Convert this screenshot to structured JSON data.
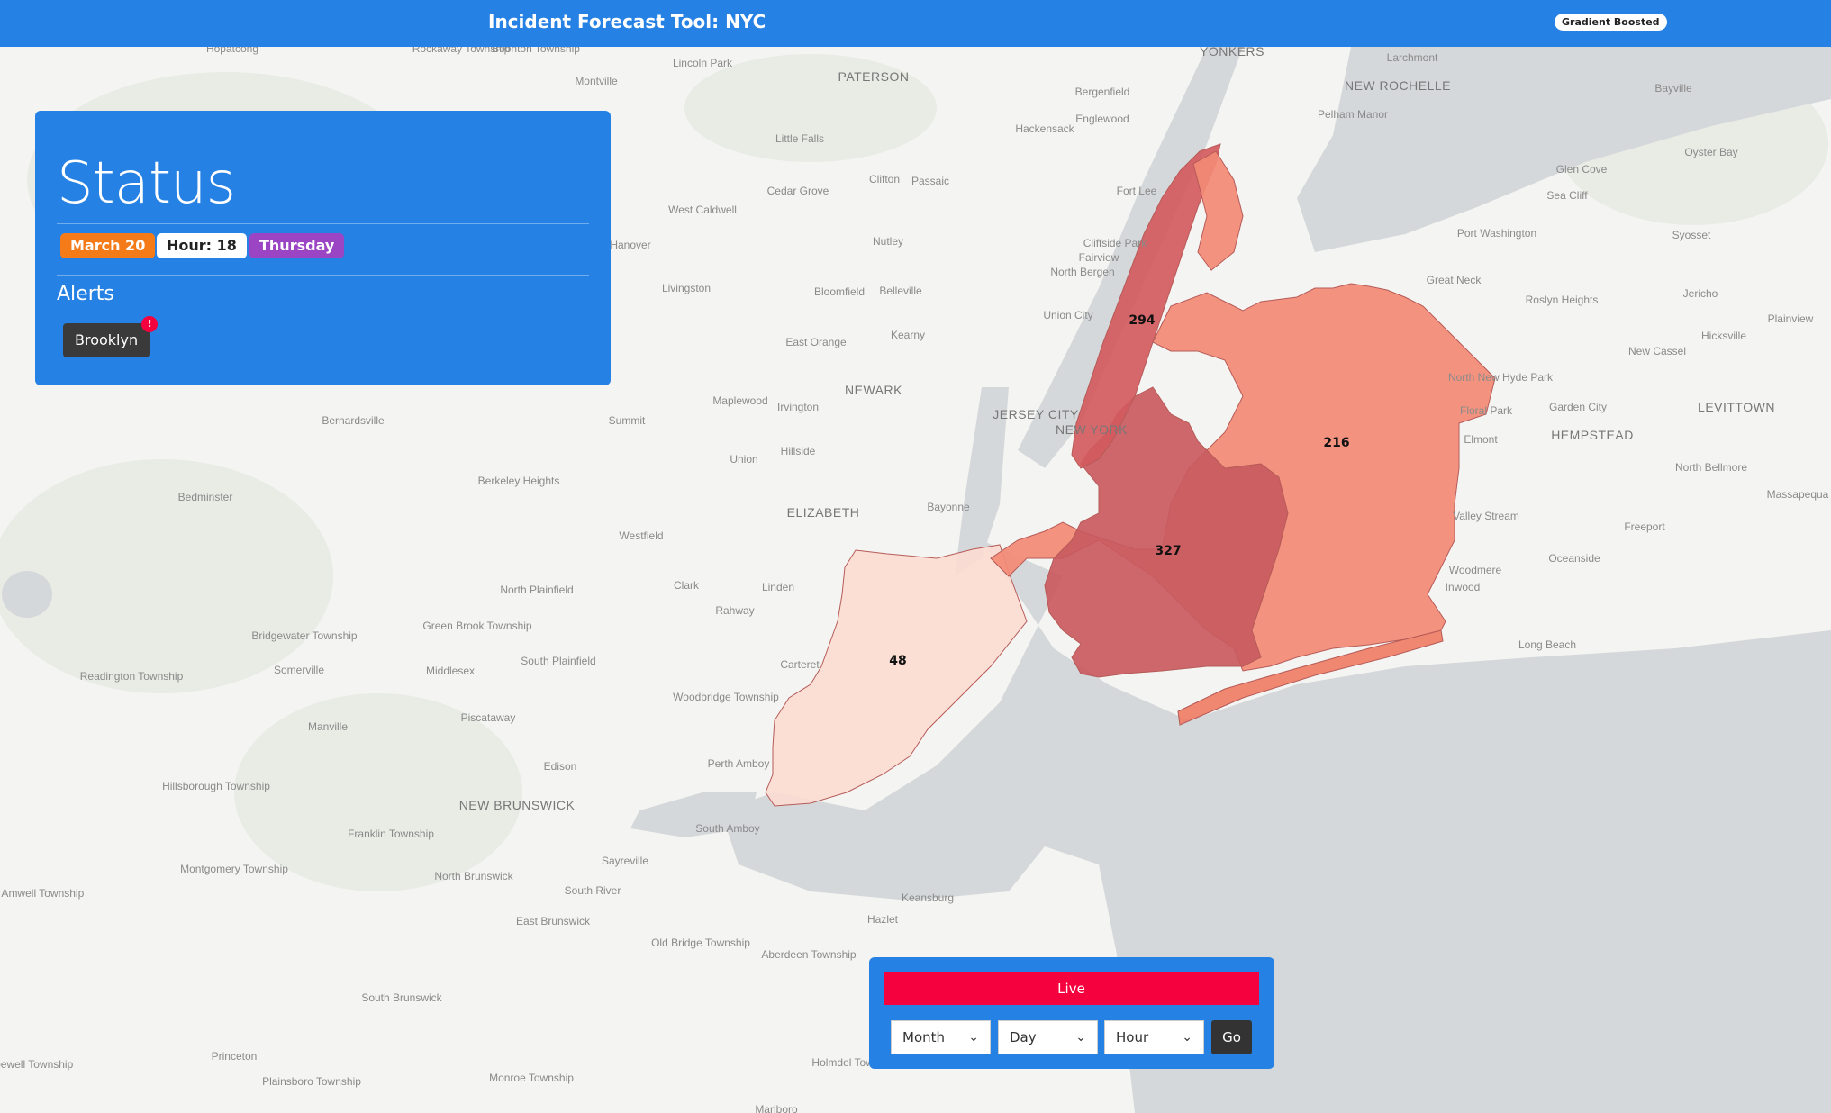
{
  "header": {
    "title": "Incident Forecast Tool: NYC",
    "model_badge": "Gradient Boosted"
  },
  "status": {
    "title": "Status",
    "date": "March 20",
    "hour_label": "Hour:",
    "hour_value": "18",
    "day": "Thursday",
    "alerts_title": "Alerts",
    "alerts": [
      {
        "borough": "Brooklyn",
        "badge": "!"
      }
    ]
  },
  "controls": {
    "live_label": "Live",
    "month_placeholder": "Month",
    "day_placeholder": "Day",
    "hour_placeholder": "Hour",
    "go_label": "Go"
  },
  "map": {
    "boroughs": [
      {
        "name": "Manhattan",
        "value": "294",
        "color": "#d25a5e"
      },
      {
        "name": "Queens",
        "value": "216",
        "color": "#f28a75"
      },
      {
        "name": "Brooklyn",
        "value": "327",
        "color": "#c95a60"
      },
      {
        "name": "Staten Island",
        "value": "48",
        "color": "#fbdcd2"
      },
      {
        "name": "Rockaway",
        "value": "",
        "color": "#ee7d66"
      }
    ],
    "place_labels": [
      "Hopatcong",
      "Rockaway Township",
      "Boonton Township",
      "Lincoln Park",
      "Montville",
      "PATERSON",
      "Bergenfield",
      "YONKERS",
      "Larchmont",
      "NEW ROCHELLE",
      "Bayville",
      "Pelham Manor",
      "Englewood",
      "Hackensack",
      "Little Falls",
      "Oyster Bay",
      "Glen Cove",
      "Sea Cliff",
      "Clifton",
      "Passaic",
      "Cedar Grove",
      "Fort Lee",
      "West Caldwell",
      "Nutley",
      "Cliffside Park",
      "Fairview",
      "Port Washington",
      "Syosset",
      "Hanover",
      "North Bergen",
      "Great Neck",
      "Livingston",
      "Bloomfield",
      "Belleville",
      "Union City",
      "Roslyn Heights",
      "Jericho",
      "Plainview",
      "Kearny",
      "East Orange",
      "New Cassel",
      "Hicksville",
      "North New Hyde Park",
      "NEWARK",
      "Maplewood",
      "Irvington",
      "JERSEY CITY",
      "NEW YORK",
      "Floral Park",
      "Garden City",
      "LEVITTOWN",
      "Bernardsville",
      "Summit",
      "Elmont",
      "HEMPSTEAD",
      "Hillside",
      "Union",
      "Berkeley Heights",
      "North Bellmore",
      "Bedminster",
      "Bayonne",
      "ELIZABETH",
      "Massapequa",
      "Valley Stream",
      "Freeport",
      "Westfield",
      "Oceanside",
      "North Plainfield",
      "Clark",
      "Linden",
      "Woodmere",
      "Inwood",
      "Rahway",
      "Bridgewater Township",
      "Green Brook Township",
      "Long Beach",
      "South Plainfield",
      "Readington Township",
      "Somerville",
      "Middlesex",
      "Carteret",
      "Woodbridge Township",
      "Piscataway",
      "Manville",
      "Perth Amboy",
      "Edison",
      "Hillsborough Township",
      "NEW BRUNSWICK",
      "Franklin Township",
      "South Amboy",
      "Montgomery Township",
      "Sayreville",
      "North Brunswick",
      "East Amwell Township",
      "South River",
      "Keansburg",
      "East Brunswick",
      "Hazlet",
      "Old Bridge Township",
      "Aberdeen Township",
      "South Brunswick",
      "Princeton",
      "Holmdel Township",
      "Hopewell Township",
      "Plainsboro Township",
      "Monroe Township",
      "Marlboro"
    ]
  }
}
